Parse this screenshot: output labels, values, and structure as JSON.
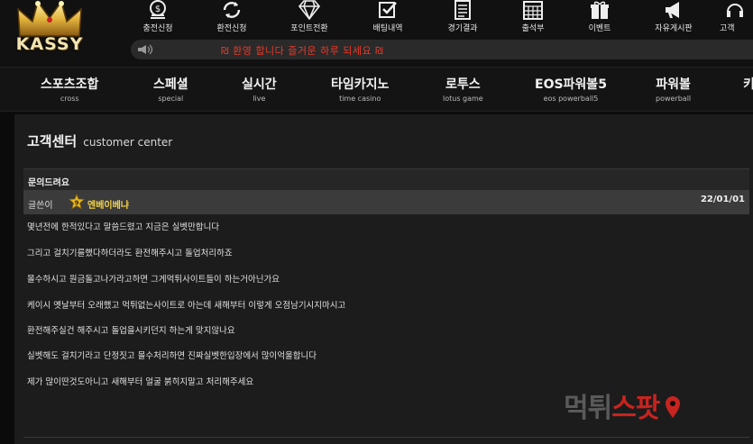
{
  "logo": {
    "text": "KASSY"
  },
  "top_nav": [
    {
      "label": "충전신청",
      "icon": "coin-stack-icon"
    },
    {
      "label": "환전신청",
      "icon": "exchange-arrows-icon"
    },
    {
      "label": "포인트전환",
      "icon": "diamond-icon"
    },
    {
      "label": "배팅내역",
      "icon": "checkbox-icon"
    },
    {
      "label": "경기결과",
      "icon": "document-list-icon"
    },
    {
      "label": "출석부",
      "icon": "calendar-icon"
    },
    {
      "label": "이벤트",
      "icon": "gift-icon"
    },
    {
      "label": "자유게시판",
      "icon": "megaphone-icon"
    },
    {
      "label": "고객",
      "icon": "headset-icon"
    }
  ],
  "notice": {
    "text": "₪ 환영 합니다 즐거운 하루 되세요 ₪"
  },
  "main_nav": [
    {
      "ko": "스포츠조합",
      "en": "cross"
    },
    {
      "ko": "스페셜",
      "en": "special"
    },
    {
      "ko": "실시간",
      "en": "live"
    },
    {
      "ko": "타임카지노",
      "en": "time casino"
    },
    {
      "ko": "로투스",
      "en": "lotus game"
    },
    {
      "ko": "EOS파워볼5",
      "en": "eos powerball5"
    },
    {
      "ko": "파워볼",
      "en": "powerball"
    },
    {
      "ko": "키",
      "en": ""
    }
  ],
  "page": {
    "title_ko": "고객센터",
    "title_en": "customer center"
  },
  "post": {
    "subject": "문의드려요",
    "author_label": "글쓴이",
    "author_level": "9",
    "author_name": "엔베이베냐",
    "date": "22/01/01",
    "lines": [
      "몇년전에 한적있다고 말씀드렸고 지금은 실벳만합니다",
      "그리고 걸치기를했다하더라도 환전해주시고 돌업처리하죠",
      "몰수하시고 원금돌고나가라고하면 그게먹튀사이트들이 하는거아닌가요",
      "케이시 옛날부터 오래했고 먹튀없는사이트로 아는데 새해부터 이렇게 오점남기시지마시고",
      "환전해주실건 해주시고 돌업을시키던지 하는게 맞지않나요",
      "실벳해도 걸치기라고 단정짓고 몰수처리하면 진짜실벳한입장에서 많이억울합니다",
      "제가 많이딴것도아니고 새해부터 얼굴 붉히지말고 처리해주세요"
    ]
  },
  "watermark": {
    "part1": "먹튀",
    "part2": "스팟"
  },
  "colors": {
    "accent_red": "#e83a2a",
    "author_gold": "#f3d34a",
    "watermark_red": "#c8241f"
  }
}
